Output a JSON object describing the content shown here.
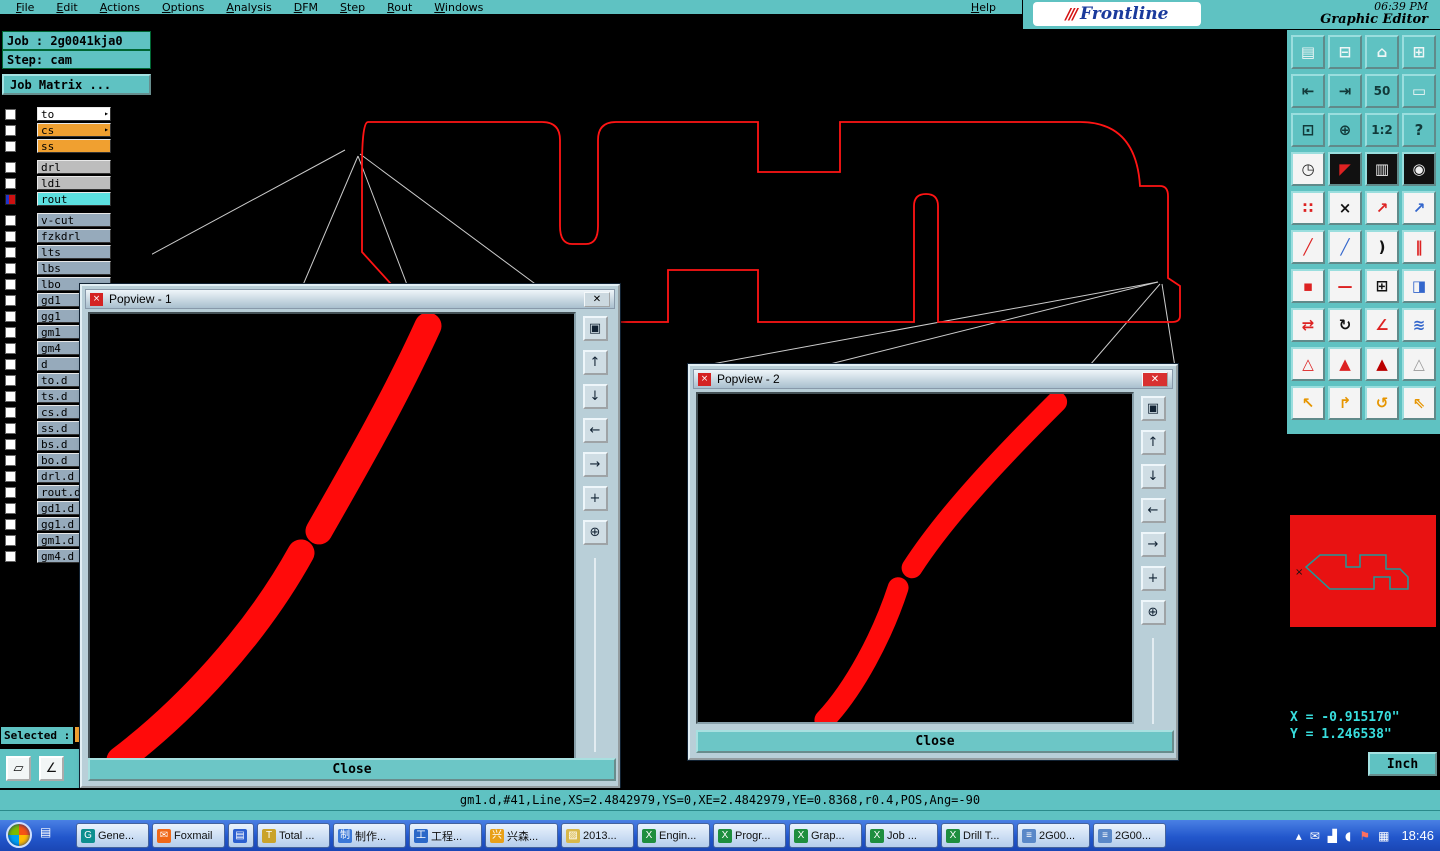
{
  "colors": {
    "teal": "#5fc2c2",
    "trace_red": "#ff0000",
    "orange": "#f0a030",
    "taskbar_blue": "#2257cc"
  },
  "menu_bar": {
    "items": [
      "File",
      "Edit",
      "Actions",
      "Options",
      "Analysis",
      "DFM",
      "Step",
      "Rout",
      "Windows",
      "Help"
    ]
  },
  "brand": {
    "logo_text": "Frontline",
    "app_title": "Graphic Editor",
    "clock": "06:39 PM"
  },
  "job_panel": {
    "job": "Job : 2g0041kja0",
    "step": "Step: cam",
    "matrix_button": "Job Matrix ..."
  },
  "layer_list": {
    "groups": [
      {
        "rows": [
          {
            "label": "to",
            "bg": "#ffffff",
            "arrow": true
          },
          {
            "label": "cs",
            "bg": "#f0a030",
            "arrow": true
          },
          {
            "label": "ss",
            "bg": "#f0a030"
          }
        ]
      },
      {
        "rows": [
          {
            "label": "drl",
            "bg": "#bdbdbd"
          },
          {
            "label": "ldi",
            "bg": "#bdbdbd"
          },
          {
            "label": "rout",
            "bg": "#5ce0e0",
            "active": true
          }
        ]
      },
      {
        "rows": [
          {
            "label": "v-cut",
            "bg": "#96aabb"
          },
          {
            "label": "fzkdrl",
            "bg": "#96aabb"
          },
          {
            "label": "lts",
            "bg": "#96aabb"
          },
          {
            "label": "lbs",
            "bg": "#96aabb"
          },
          {
            "label": "lbo",
            "bg": "#96aabb"
          },
          {
            "label": "gd1",
            "bg": "#96aabb"
          },
          {
            "label": "gg1",
            "bg": "#96aabb"
          },
          {
            "label": "gm1",
            "bg": "#96aabb"
          },
          {
            "label": "gm4",
            "bg": "#96aabb"
          },
          {
            "label": "d",
            "bg": "#96aabb"
          },
          {
            "label": "to.d",
            "bg": "#96aabb"
          },
          {
            "label": "ts.d",
            "bg": "#96aabb"
          },
          {
            "label": "cs.d",
            "bg": "#96aabb"
          },
          {
            "label": "ss.d",
            "bg": "#96aabb"
          },
          {
            "label": "bs.d",
            "bg": "#96aabb"
          },
          {
            "label": "bo.d",
            "bg": "#96aabb"
          },
          {
            "label": "drl.d",
            "bg": "#96aabb"
          },
          {
            "label": "rout.d",
            "bg": "#96aabb"
          },
          {
            "label": "gd1.d",
            "bg": "#96aabb"
          },
          {
            "label": "gg1.d",
            "bg": "#96aabb"
          },
          {
            "label": "gm1.d",
            "bg": "#96aabb"
          },
          {
            "label": "gm4.d",
            "bg": "#96aabb"
          }
        ]
      }
    ]
  },
  "popviews": [
    {
      "title": "Popview - 1",
      "close": "Close"
    },
    {
      "title": "Popview - 2",
      "close": "Close"
    }
  ],
  "popview_tools": [
    {
      "name": "stack-windows-icon",
      "glyph": "▣"
    },
    {
      "name": "scroll-up-icon",
      "glyph": "↑"
    },
    {
      "name": "scroll-down-icon",
      "glyph": "↓"
    },
    {
      "name": "scroll-left-icon",
      "glyph": "←"
    },
    {
      "name": "scroll-right-icon",
      "glyph": "→"
    },
    {
      "name": "pan-icon",
      "glyph": "+"
    },
    {
      "name": "zoom-icon",
      "glyph": "⊕"
    }
  ],
  "toolbar": {
    "buttons": [
      {
        "name": "copy-board-icon",
        "glyph": "▤",
        "fg": "#eef6f6",
        "bg": "#5fc2c2"
      },
      {
        "name": "screen-icon",
        "glyph": "⊟",
        "fg": "#eef6f6",
        "bg": "#5fc2c2"
      },
      {
        "name": "home-icon",
        "glyph": "⌂",
        "fg": "#eef6f6",
        "bg": "#5fc2c2"
      },
      {
        "name": "tile-windows-icon",
        "glyph": "⊞",
        "fg": "#eef6f6",
        "bg": "#5fc2c2"
      },
      {
        "name": "pan-left-icon",
        "glyph": "⇤",
        "fg": "#123a3a",
        "bg": "#5fc2c2"
      },
      {
        "name": "pan-right-icon",
        "glyph": "⇥",
        "fg": "#123a3a",
        "bg": "#5fc2c2"
      },
      {
        "name": "zoom-50-icon",
        "glyph": "50",
        "fg": "#123a3a",
        "bg": "#5fc2c2"
      },
      {
        "name": "panel-icon",
        "glyph": "▭",
        "fg": "#eef6f6",
        "bg": "#5fc2c2"
      },
      {
        "name": "zoom-window-icon",
        "glyph": "⊡",
        "fg": "#123a3a",
        "bg": "#5fc2c2"
      },
      {
        "name": "center-icon",
        "glyph": "⊕",
        "fg": "#123a3a",
        "bg": "#5fc2c2"
      },
      {
        "name": "scale-1-2-icon",
        "glyph": "1:2",
        "fg": "#123a3a",
        "bg": "#5fc2c2"
      },
      {
        "name": "help-icon",
        "glyph": "?",
        "fg": "#123a3a",
        "bg": "#5fc2c2"
      },
      {
        "name": "clock-icon",
        "glyph": "◷",
        "fg": "#222222",
        "bg": "#f4f4f4"
      },
      {
        "name": "pointer-red-icon",
        "glyph": "◤",
        "fg": "#dd2222",
        "bg": "#111111"
      },
      {
        "name": "ruler-icon",
        "glyph": "▥",
        "fg": "#eeeeee",
        "bg": "#111111"
      },
      {
        "name": "dot-grid-icon",
        "glyph": "◉",
        "fg": "#eeeeee",
        "bg": "#111111"
      },
      {
        "name": "pads-icon",
        "glyph": "∷",
        "fg": "#dd2222",
        "bg": "#f4f4f4"
      },
      {
        "name": "delete-icon",
        "glyph": "×",
        "fg": "#111111",
        "bg": "#f4f4f4"
      },
      {
        "name": "move-points-icon",
        "glyph": "↗",
        "fg": "#dd2222",
        "bg": "#f4f4f4"
      },
      {
        "name": "copy-points-icon",
        "glyph": "↗",
        "fg": "#3366cc",
        "bg": "#f4f4f4"
      },
      {
        "name": "line-red-icon",
        "glyph": "╱",
        "fg": "#dd2222",
        "bg": "#f4f4f4"
      },
      {
        "name": "line-blue-icon",
        "glyph": "╱",
        "fg": "#3366cc",
        "bg": "#f4f4f4"
      },
      {
        "name": "arc-icon",
        "glyph": ")",
        "fg": "#111111",
        "bg": "#f4f4f4"
      },
      {
        "name": "parallel-icon",
        "glyph": "‖",
        "fg": "#dd2222",
        "bg": "#f4f4f4"
      },
      {
        "name": "pad-red-icon",
        "glyph": "▪",
        "fg": "#dd2222",
        "bg": "#f4f4f4"
      },
      {
        "name": "dash-red-icon",
        "glyph": "—",
        "fg": "#dd2222",
        "bg": "#f4f4f4"
      },
      {
        "name": "measure-box-icon",
        "glyph": "⊞",
        "fg": "#111111",
        "bg": "#f4f4f4"
      },
      {
        "name": "half-plane-icon",
        "glyph": "◨",
        "fg": "#3366cc",
        "bg": "#f4f4f4"
      },
      {
        "name": "swap-icon",
        "glyph": "⇄",
        "fg": "#dd2222",
        "bg": "#f4f4f4"
      },
      {
        "name": "rotate-icon",
        "glyph": "↻",
        "fg": "#111111",
        "bg": "#f4f4f4"
      },
      {
        "name": "angle-icon",
        "glyph": "∠",
        "fg": "#dd2222",
        "bg": "#f4f4f4"
      },
      {
        "name": "wave-icon",
        "glyph": "≋",
        "fg": "#3366cc",
        "bg": "#f4f4f4"
      },
      {
        "name": "triangle-outline-icon",
        "glyph": "△",
        "fg": "#dd2222",
        "bg": "#f4f4f4"
      },
      {
        "name": "triangle-solid-icon",
        "glyph": "▲",
        "fg": "#dd2222",
        "bg": "#f4f4f4"
      },
      {
        "name": "triangle-red-icon",
        "glyph": "▲",
        "fg": "#bb0000",
        "bg": "#f4f4f4"
      },
      {
        "name": "triangle-dim-icon",
        "glyph": "△",
        "fg": "#999999",
        "bg": "#f4f4f4"
      },
      {
        "name": "select-icon",
        "glyph": "↖",
        "fg": "#e69500",
        "bg": "#f4f4f4"
      },
      {
        "name": "select-box-icon",
        "glyph": "↱",
        "fg": "#e69500",
        "bg": "#f4f4f4"
      },
      {
        "name": "select-arc-icon",
        "glyph": "↺",
        "fg": "#e69500",
        "bg": "#f4f4f4"
      },
      {
        "name": "select-net-icon",
        "glyph": "⇖",
        "fg": "#e69500",
        "bg": "#f4f4f4"
      }
    ]
  },
  "readout": {
    "x": "X = -0.915170\"",
    "y": "Y = 1.246538\"",
    "units": "Inch"
  },
  "selected": {
    "label": "Selected :"
  },
  "bl_tools": [
    {
      "name": "shape-tool-button",
      "glyph": "▱"
    },
    {
      "name": "angle-tool-button",
      "glyph": "∠"
    }
  ],
  "status_line": "gm1.d,#41,Line,XS=2.4842979,YS=0,XE=2.4842979,YE=0.8368,r0.4,POS,Ang=-90",
  "taskbar": {
    "items": [
      {
        "label": "Gene...",
        "glyph": "G",
        "color": "#0d8f8f"
      },
      {
        "label": "Foxmail",
        "glyph": "✉",
        "color": "#f06818"
      },
      {
        "label": "",
        "glyph": "▤",
        "color": "#2b5fd0"
      },
      {
        "label": "Total ...",
        "glyph": "T",
        "color": "#caa32a"
      },
      {
        "label": "制作...",
        "glyph": "制",
        "color": "#3a78d8"
      },
      {
        "label": "工程...",
        "glyph": "工",
        "color": "#2a68c8"
      },
      {
        "label": "兴森...",
        "glyph": "兴",
        "color": "#e8a018"
      },
      {
        "label": "2013...",
        "glyph": "▨",
        "color": "#d8b84a"
      },
      {
        "label": "Engin...",
        "glyph": "X",
        "color": "#1e8e3e"
      },
      {
        "label": "Progr...",
        "glyph": "X",
        "color": "#1e8e3e"
      },
      {
        "label": "Grap...",
        "glyph": "X",
        "color": "#1e8e3e"
      },
      {
        "label": "Job ...",
        "glyph": "X",
        "color": "#1e8e3e"
      },
      {
        "label": "Drill T...",
        "glyph": "X",
        "color": "#1e8e3e"
      },
      {
        "label": "2G00...",
        "glyph": "≡",
        "color": "#5a88c8"
      },
      {
        "label": "2G00...",
        "glyph": "≡",
        "color": "#5a88c8"
      }
    ],
    "tray_icons": [
      {
        "name": "show-hidden-icon",
        "glyph": "▴"
      },
      {
        "name": "message-icon",
        "glyph": "✉"
      },
      {
        "name": "network-icon",
        "glyph": "▟"
      },
      {
        "name": "volume-icon",
        "glyph": "◖"
      },
      {
        "name": "flag-icon",
        "glyph": "⚑",
        "color": "#ff7060"
      },
      {
        "name": "input-indicator-icon",
        "glyph": "▦"
      }
    ],
    "tray_time": "18:46"
  }
}
